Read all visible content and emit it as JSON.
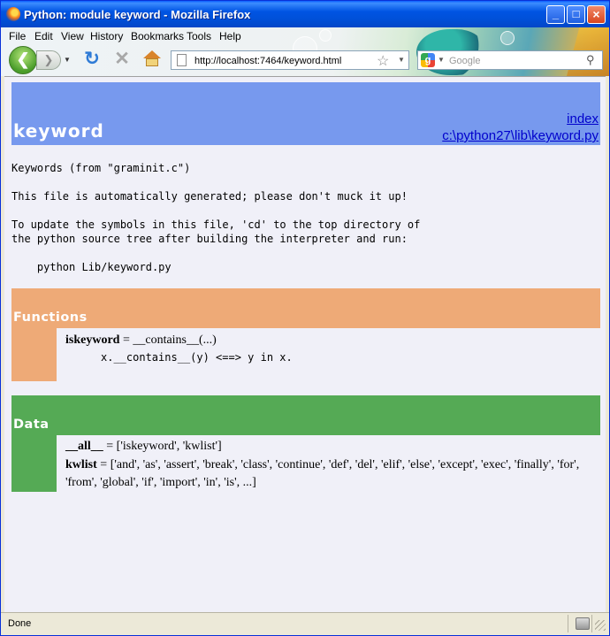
{
  "window": {
    "title": "Python: module keyword - Mozilla Firefox"
  },
  "menus": [
    "File",
    "Edit",
    "View",
    "History",
    "Bookmarks",
    "Tools",
    "Help"
  ],
  "nav": {
    "url": "http://localhost:7464/keyword.html",
    "search_placeholder": "Google"
  },
  "page": {
    "module_name": "keyword",
    "link_index": "index",
    "link_file": "c:\\python27\\lib\\keyword.py",
    "docstring": "Keywords (from \"graminit.c\")\n\nThis file is automatically generated; please don't muck it up!\n\nTo update the symbols in this file, 'cd' to the top directory of\nthe python source tree after building the interpreter and run:\n\n    python Lib/keyword.py",
    "functions": {
      "title": "Functions",
      "name": "iskeyword",
      "signature": " = __contains__(...)",
      "doc": "x.__contains__(y) <==> y in x."
    },
    "data": {
      "title": "Data",
      "all_name": "__all__",
      "all_value": " = ['iskeyword', 'kwlist']",
      "kwlist_name": "kwlist",
      "kwlist_value": " = ['and', 'as', 'assert', 'break', 'class', 'continue', 'def', 'del', 'elif', 'else', 'except', 'exec', 'finally', 'for', 'from', 'global', 'if', 'import', 'in', 'is', ...]"
    }
  },
  "status": {
    "text": "Done"
  },
  "colors": {
    "heading": "#7799ee",
    "functions": "#eeaa77",
    "data": "#55aa55",
    "link": "#0000cc"
  }
}
